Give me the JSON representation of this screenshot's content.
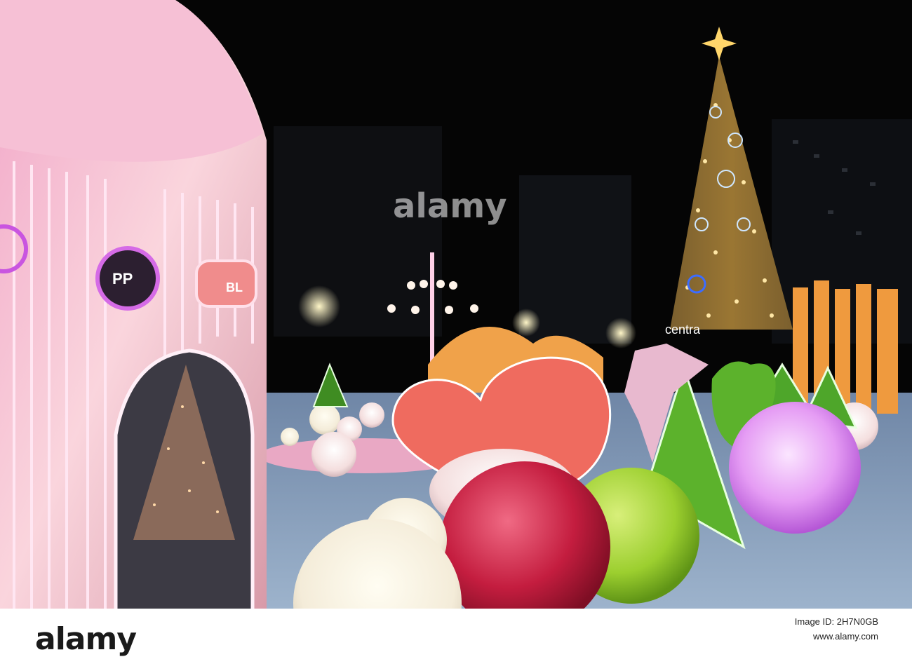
{
  "watermark": {
    "brand": "alamy",
    "center_text": "alamy"
  },
  "footer": {
    "brand": "alamy",
    "image_id_label": "Image ID: 2H7N0GB",
    "url": "www.alamy.com"
  },
  "scene": {
    "tree_sign_text": "centra",
    "neon_signs": [
      "PP",
      "BL"
    ]
  },
  "colors": {
    "night_sky": "#050505",
    "neon_pink": "#ff7fd6",
    "heart_coral": "#ef6b5f",
    "tree_gold": "#f3c266",
    "ball_purple": "#e59cf4",
    "ball_green": "#9ccf2f",
    "ball_red": "#c41d3f"
  }
}
